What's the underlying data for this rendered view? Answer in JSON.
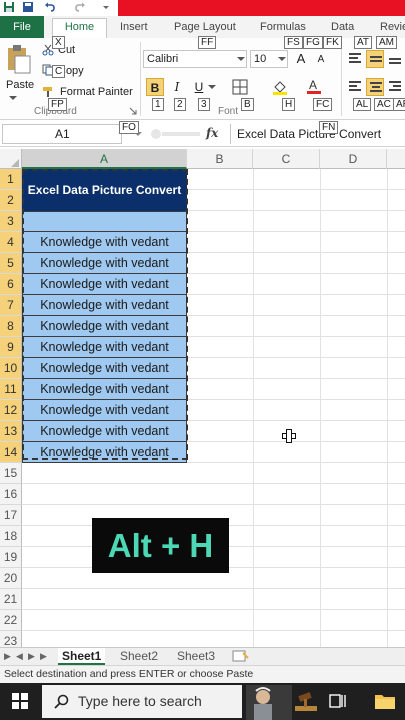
{
  "ribbon": {
    "tabs": [
      "File",
      "Home",
      "Insert",
      "Page Layout",
      "Formulas",
      "Data",
      "Revie"
    ],
    "keytips": {
      "file": "F",
      "home": "H",
      "page_layout": "FF",
      "fs": "FS",
      "fg": "FG",
      "fk": "FK",
      "at": "AT",
      "am": "AM",
      "cut": "X",
      "copy": "C",
      "format_painter": "FP",
      "clipboard_group": "FO",
      "font_name": "FF",
      "bold": "1",
      "italic": "2",
      "underline": "3",
      "borders": "B",
      "fill": "H",
      "font_color": "FC",
      "align_left": "AL",
      "align_center": "AC",
      "align_right": "AR",
      "fn": "FN"
    },
    "clipboard": {
      "paste_label": "Paste",
      "cut_label": "Cut",
      "copy_label": "Copy",
      "format_painter_label": "Format Painter",
      "group_label": "Clipboard"
    },
    "font": {
      "name": "Calibri",
      "size": "10",
      "group_label": "Font",
      "bold": "B",
      "italic": "I",
      "underline": "U",
      "grow": "A",
      "shrink": "A"
    }
  },
  "formula_bar": {
    "name_box": "A1",
    "fx": "fx",
    "content": "Excel Data Picture Convert"
  },
  "grid": {
    "columns": [
      "A",
      "B",
      "C",
      "D"
    ],
    "rows": [
      "1",
      "2",
      "3",
      "4",
      "5",
      "6",
      "7",
      "8",
      "9",
      "10",
      "11",
      "12",
      "13",
      "14",
      "15",
      "16",
      "17",
      "18",
      "19",
      "20",
      "21",
      "22",
      "23"
    ],
    "title_cell": "Excel Data Picture Convert",
    "cells": [
      "Knowledge with vedant",
      "Knowledge with vedant",
      "Knowledge with vedant",
      "Knowledge with vedant",
      "Knowledge with vedant",
      "Knowledge with vedant",
      "Knowledge with vedant",
      "Knowledge with vedant",
      "Knowledge with vedant",
      "Knowledge with vedant",
      "Knowledge with vedant"
    ]
  },
  "overlay": {
    "text": "Alt + H"
  },
  "sheets": [
    "Sheet1",
    "Sheet2",
    "Sheet3"
  ],
  "status": {
    "message": "Select destination and press ENTER or choose Paste"
  },
  "taskbar": {
    "search_placeholder": "Type here to search"
  },
  "colors": {
    "excel_green": "#217346",
    "title_fill": "#0b2f6a",
    "cell_fill": "#9fc9f0",
    "selected_row_header": "#f5d27a",
    "overlay_text": "#4dd8b5"
  }
}
